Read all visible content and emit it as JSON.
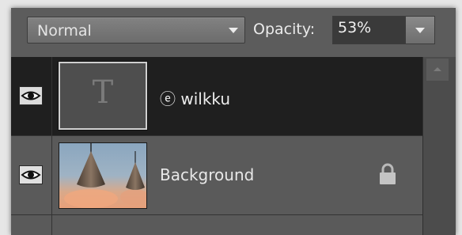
{
  "toolbar": {
    "blend_mode": "Normal",
    "opacity_label": "Opacity:",
    "opacity_value": "53%"
  },
  "layers": [
    {
      "name": "ⓔ wilkku",
      "type": "text",
      "thumbnail_glyph": "T",
      "selected": true,
      "visible": true
    },
    {
      "name": "Background",
      "type": "image",
      "selected": false,
      "visible": true,
      "locked": true
    }
  ],
  "icons": {
    "eye": "eye-icon",
    "lock": "lock-icon",
    "dropdown": "chevron-down-icon",
    "scroll_up": "arrow-up-icon"
  },
  "colors": {
    "panel_bg": "#5c5c5c",
    "selected_row_bg": "#1f1f1f",
    "text": "#ededed"
  }
}
